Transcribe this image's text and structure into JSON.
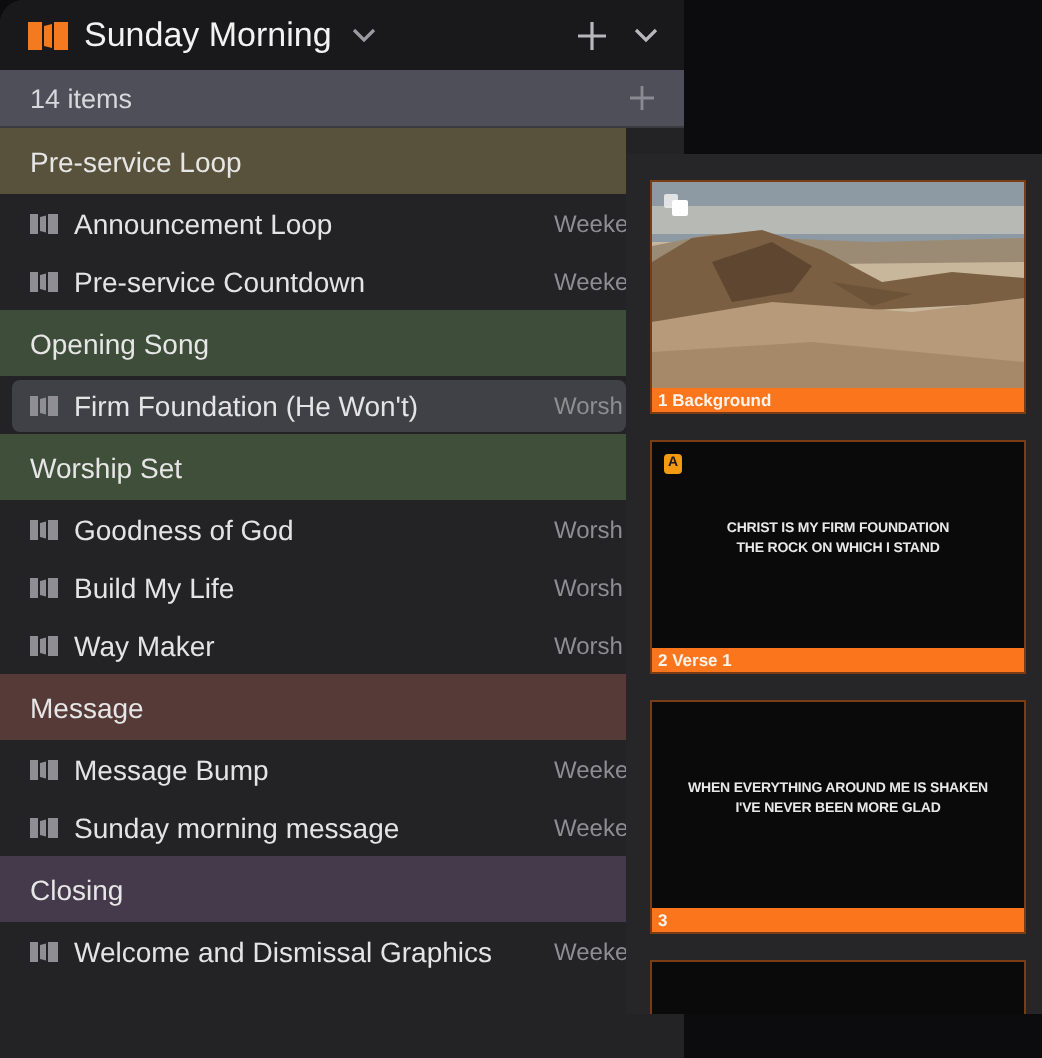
{
  "header": {
    "title": "Sunday Morning"
  },
  "list": {
    "count": "14 items"
  },
  "groups": [
    {
      "name": "Pre-service Loop",
      "color": "#58523c",
      "items": [
        {
          "title": "Announcement Loop",
          "meta": "Weeke",
          "selected": false
        },
        {
          "title": "Pre-service Countdown",
          "meta": "Weeke",
          "selected": false
        }
      ]
    },
    {
      "name": "Opening Song",
      "color": "#3e4d3a",
      "items": [
        {
          "title": "Firm Foundation (He Won't)",
          "meta": "Worsh",
          "selected": true
        }
      ]
    },
    {
      "name": "Worship Set",
      "color": "#3f4f39",
      "items": [
        {
          "title": "Goodness of God",
          "meta": "Worsh",
          "selected": false
        },
        {
          "title": "Build My Life",
          "meta": "Worsh",
          "selected": false
        },
        {
          "title": "Way Maker",
          "meta": "Worsh",
          "selected": false
        }
      ]
    },
    {
      "name": "Message",
      "color": "#553a38",
      "items": [
        {
          "title": "Message Bump",
          "meta": "Weeke",
          "selected": false
        },
        {
          "title": "Sunday morning message",
          "meta": "Weeke",
          "selected": false
        }
      ]
    },
    {
      "name": "Closing",
      "color": "#453a4b",
      "items": [
        {
          "title": "Welcome and Dismissal Graphics",
          "meta": "Weeke",
          "selected": false
        }
      ]
    }
  ],
  "slides": [
    {
      "kind": "picture",
      "label": "1 Background"
    },
    {
      "kind": "lyrics",
      "badge": "A",
      "lines": [
        "CHRIST IS MY FIRM FOUNDATION",
        "THE ROCK ON WHICH I STAND"
      ],
      "label": "2 Verse 1"
    },
    {
      "kind": "lyrics",
      "lines": [
        "WHEN EVERYTHING AROUND ME IS SHAKEN",
        "I'VE NEVER BEEN MORE GLAD"
      ],
      "label": "3"
    },
    {
      "kind": "lyrics"
    }
  ]
}
